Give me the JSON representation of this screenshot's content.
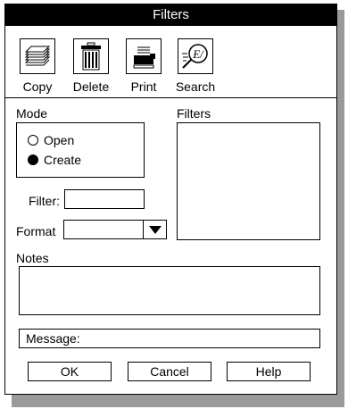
{
  "window": {
    "title": "Filters"
  },
  "toolbar": {
    "copy_label": "Copy",
    "delete_label": "Delete",
    "print_label": "Print",
    "search_label": "Search"
  },
  "mode": {
    "label": "Mode",
    "options": [
      "Open",
      "Create"
    ],
    "selected": "Create"
  },
  "filters_list": {
    "label": "Filters"
  },
  "filter_field": {
    "label": "Filter:",
    "value": ""
  },
  "format_field": {
    "label": "Format",
    "value": ""
  },
  "notes": {
    "label": "Notes",
    "value": ""
  },
  "message": {
    "label": "Message:"
  },
  "buttons": {
    "ok": "OK",
    "cancel": "Cancel",
    "help": "Help"
  },
  "colors": {
    "titlebar": "#000000",
    "shadow": "#9a9a9a",
    "background": "#ffffff"
  },
  "icons": [
    "copy-icon",
    "delete-icon",
    "print-icon",
    "search-icon",
    "chevron-down-icon"
  ]
}
